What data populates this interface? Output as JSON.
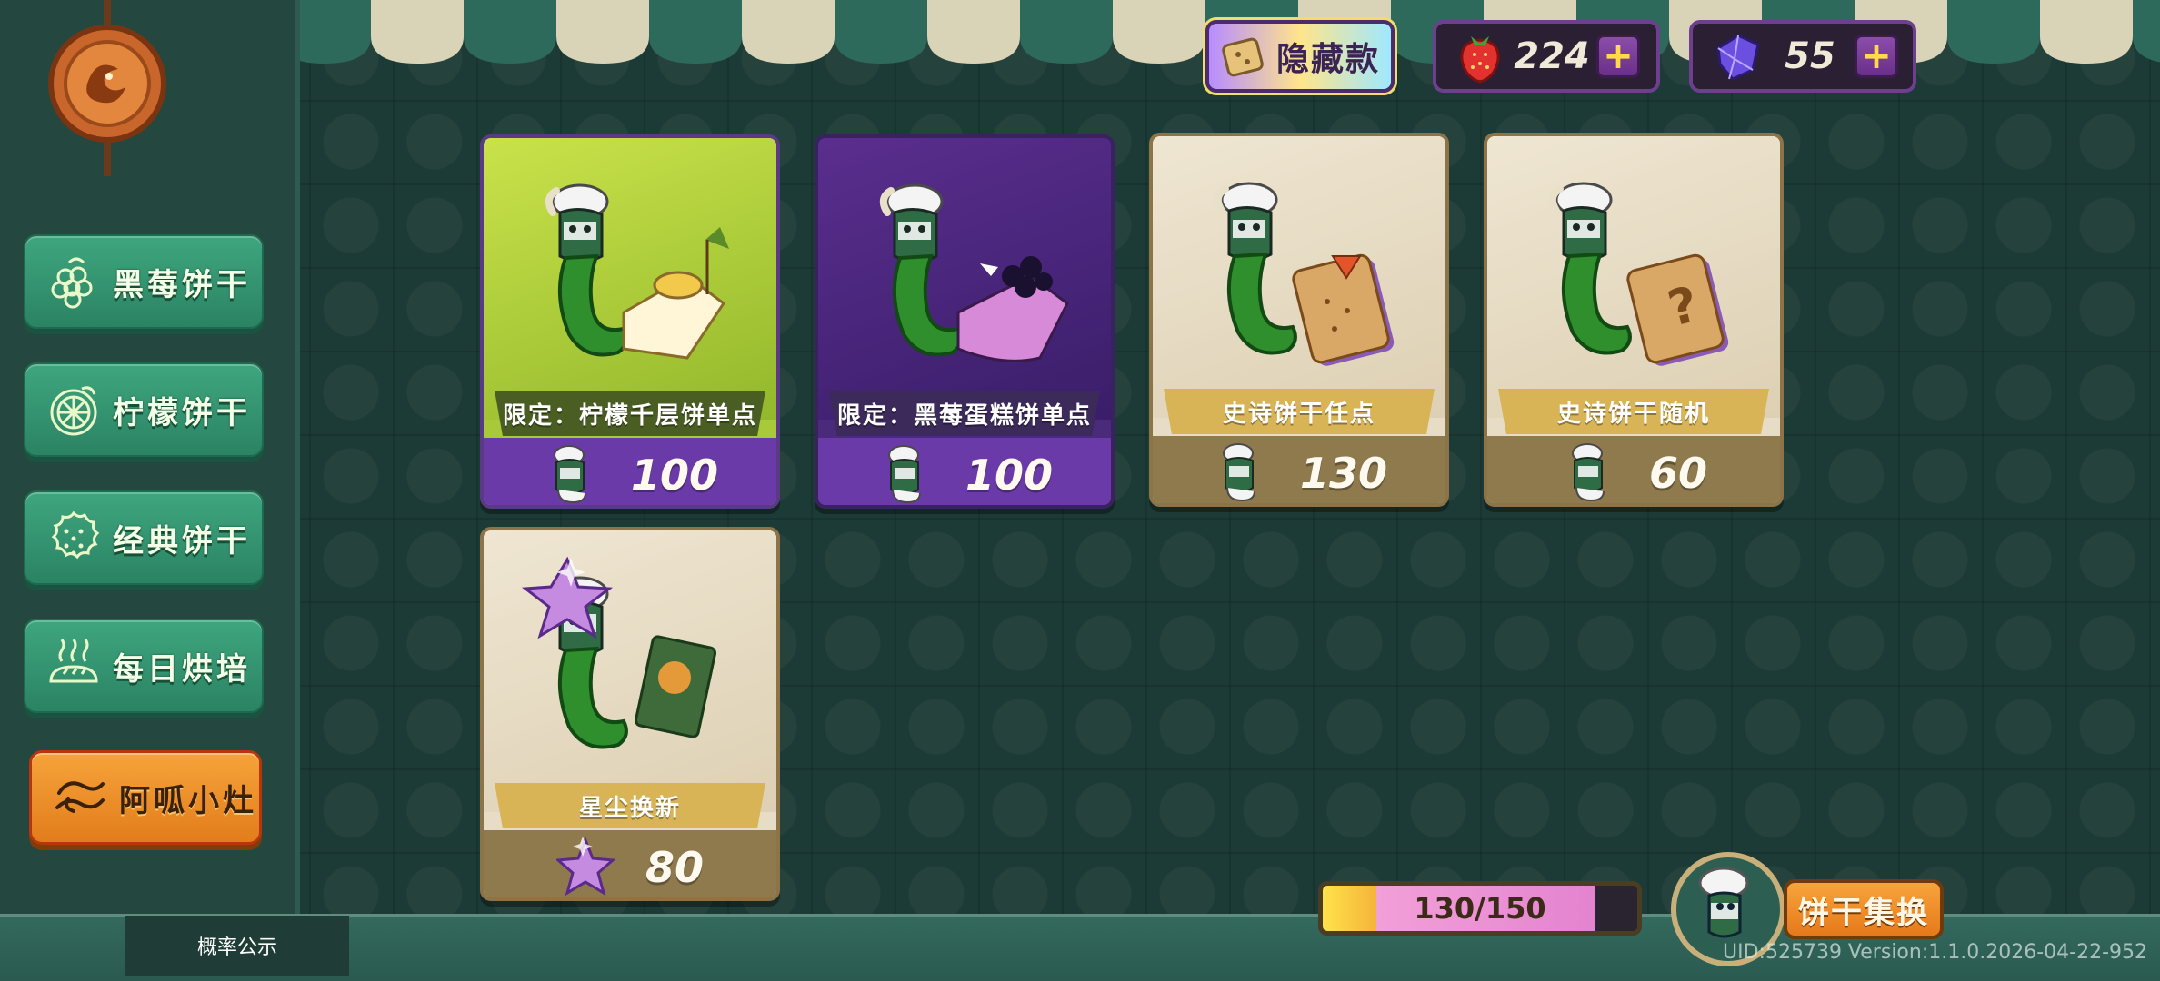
{
  "top_bar": {
    "hidden_badge_label": "隐藏款",
    "strawberry": {
      "value": "224",
      "icon": "strawberry-icon"
    },
    "crystal": {
      "value": "55",
      "icon": "crystal-icon"
    },
    "plus_symbol": "+"
  },
  "sidebar": {
    "items": [
      {
        "label": "黑莓饼干",
        "icon": "blackberry-icon"
      },
      {
        "label": "柠檬饼干",
        "icon": "lemon-icon"
      },
      {
        "label": "经典饼干",
        "icon": "cookie-icon"
      },
      {
        "label": "每日烘培",
        "icon": "bread-icon"
      },
      {
        "label": "阿呱小灶",
        "icon": "swirl-icon",
        "active": true
      }
    ]
  },
  "cards": [
    {
      "title": "限定：柠檬千层饼单点",
      "price": "100",
      "currency_icon": "chef-mascot-icon",
      "item_icon": "lemon-cake-icon"
    },
    {
      "title": "限定：黑莓蛋糕饼单点",
      "price": "100",
      "currency_icon": "chef-mascot-icon",
      "item_icon": "blackberry-cake-icon"
    },
    {
      "title": "史诗饼干任点",
      "price": "130",
      "currency_icon": "chef-mascot-icon",
      "item_icon": "cookie-arrow-icon"
    },
    {
      "title": "史诗饼干随机",
      "price": "60",
      "currency_icon": "chef-mascot-icon",
      "item_icon": "cookie-question-icon"
    },
    {
      "title": "星尘换新",
      "price": "80",
      "currency_icon": "stardust-icon",
      "item_icon": "card-pack-icon"
    }
  ],
  "progress": {
    "text": "130/150",
    "current": 130,
    "max": 150
  },
  "exchange_button": "饼干集换",
  "probability_button": "概率公示",
  "version_text": "UID:525739 Version:1.1.0.2026-04-22-952",
  "colors": {
    "bg": "#1d3b36",
    "tab_green": "#3ea67f",
    "tab_orange": "#f6a33a",
    "card_purple": "#6a3aa8",
    "card_epic": "#8f7a4e"
  }
}
